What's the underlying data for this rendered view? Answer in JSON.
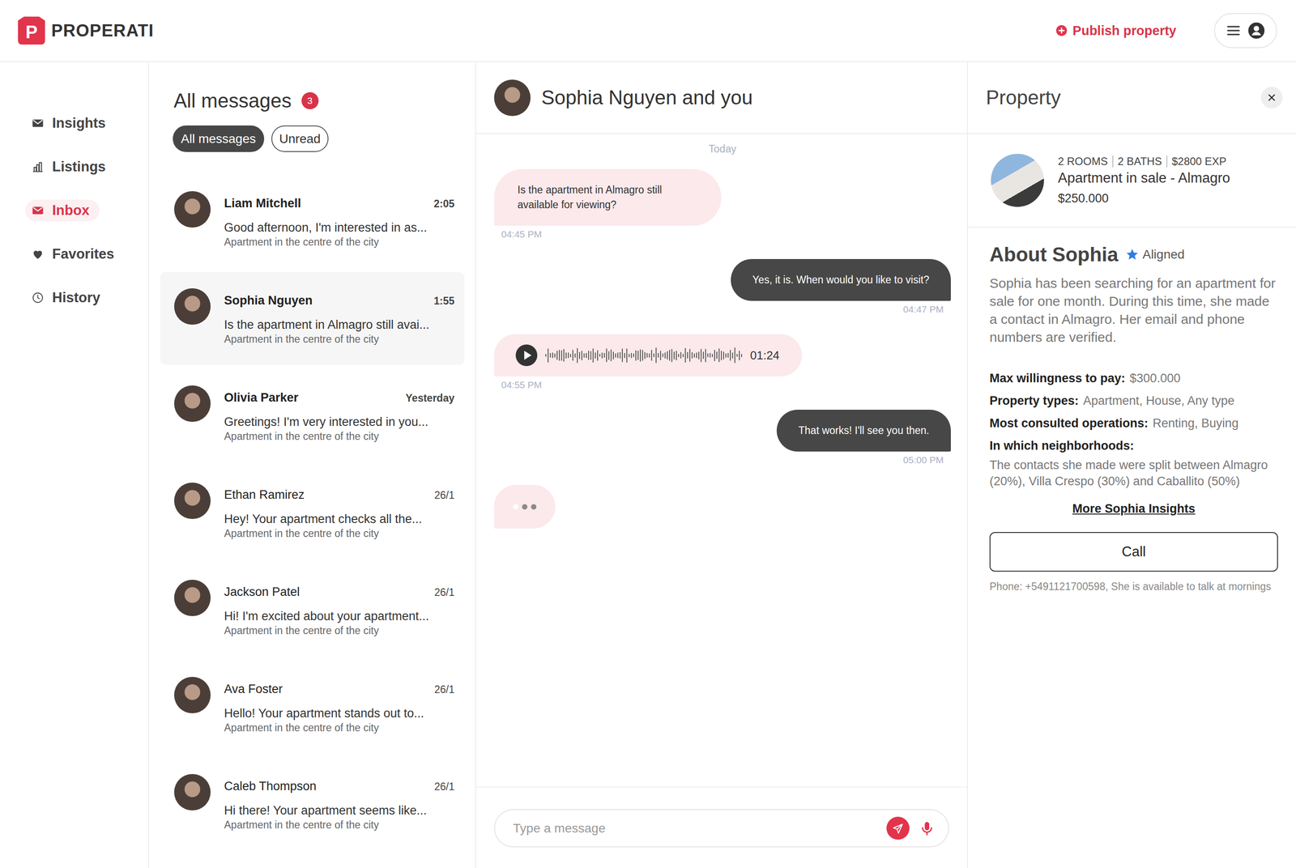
{
  "header": {
    "logo_letter": "P",
    "logo_text": "PROPERATI",
    "publish": "Publish property"
  },
  "nav": [
    {
      "label": "Insights",
      "selected": false
    },
    {
      "label": "Listings",
      "selected": false
    },
    {
      "label": "Inbox",
      "selected": true
    },
    {
      "label": "Favorites",
      "selected": false
    },
    {
      "label": "History",
      "selected": false
    }
  ],
  "inbox": {
    "title": "All messages",
    "count": "3",
    "filters": [
      {
        "label": "All messages",
        "selected": true
      },
      {
        "label": "Unread",
        "selected": false
      }
    ],
    "conversations": [
      {
        "name": "Liam Mitchell",
        "time": "2:05",
        "preview": "Good afternoon, I'm interested in as...",
        "subtitle": "Apartment in the centre of the city",
        "unread": true,
        "selected": false
      },
      {
        "name": "Sophia Nguyen",
        "time": "1:55",
        "preview": "Is the apartment in Almagro still avai...",
        "subtitle": "Apartment in the centre of the city",
        "unread": true,
        "selected": true
      },
      {
        "name": "Olivia Parker",
        "time": "Yesterday",
        "preview": "Greetings! I'm very interested in you...",
        "subtitle": "Apartment in the centre of the city",
        "unread": true,
        "selected": false
      },
      {
        "name": "Ethan Ramirez",
        "time": "26/1",
        "preview": "Hey! Your apartment checks all the...",
        "subtitle": "Apartment in the centre of the city",
        "unread": false,
        "selected": false
      },
      {
        "name": "Jackson Patel",
        "time": "26/1",
        "preview": "Hi! I'm excited about your apartment...",
        "subtitle": "Apartment in the centre of the city",
        "unread": false,
        "selected": false
      },
      {
        "name": "Ava Foster",
        "time": "26/1",
        "preview": "Hello! Your apartment stands out to...",
        "subtitle": "Apartment in the centre of the city",
        "unread": false,
        "selected": false
      },
      {
        "name": "Caleb Thompson",
        "time": "26/1",
        "preview": "Hi there! Your apartment seems like...",
        "subtitle": "Apartment in the centre of the city",
        "unread": false,
        "selected": false
      }
    ]
  },
  "chat": {
    "title": "Sophia Nguyen and you",
    "day": "Today",
    "messages": [
      {
        "kind": "text",
        "from_me": false,
        "text": "Is the apartment in Almagro still available for viewing?",
        "time": "04:45 PM"
      },
      {
        "kind": "text",
        "from_me": true,
        "text": "Yes, it is. When would you like to visit?",
        "time": "04:47 PM"
      },
      {
        "kind": "audio",
        "from_me": false,
        "duration": "01:24",
        "time": "04:55 PM"
      },
      {
        "kind": "text",
        "from_me": true,
        "text": "That works! I'll see you then.",
        "time": "05:00 PM"
      },
      {
        "kind": "typing",
        "from_me": false
      }
    ],
    "input": {
      "placeholder": "Type a message"
    }
  },
  "panel": {
    "title": "Property",
    "property": {
      "facts": [
        "2 ROOMS",
        "2 BATHS",
        "$2800 EXP"
      ],
      "title": "Apartment in sale - Almagro",
      "price": "$250.000"
    },
    "about": {
      "heading": "About Sophia",
      "badge": "Aligned",
      "description": "Sophia has been searching for an apartment for sale for one month. During this time, she made a contact in Almagro. Her email and phone numbers are verified.",
      "details": [
        {
          "kind": "inline",
          "label": "Max willingness to pay:",
          "value": "$300.000"
        },
        {
          "kind": "inline",
          "label": "Property types:",
          "value": "Apartment, House, Any type"
        },
        {
          "kind": "inline",
          "label": "Most consulted operations:",
          "value": "Renting, Buying"
        },
        {
          "kind": "block",
          "label": "In which neighborhoods:",
          "value": "The contacts she made were split between Almagro (20%), Villa Crespo (30%) and Caballito (50%)"
        }
      ],
      "link": "More Sophia Insights",
      "call": "Call",
      "note": "Phone: +5491121700598, She is available to talk at mornings"
    }
  }
}
